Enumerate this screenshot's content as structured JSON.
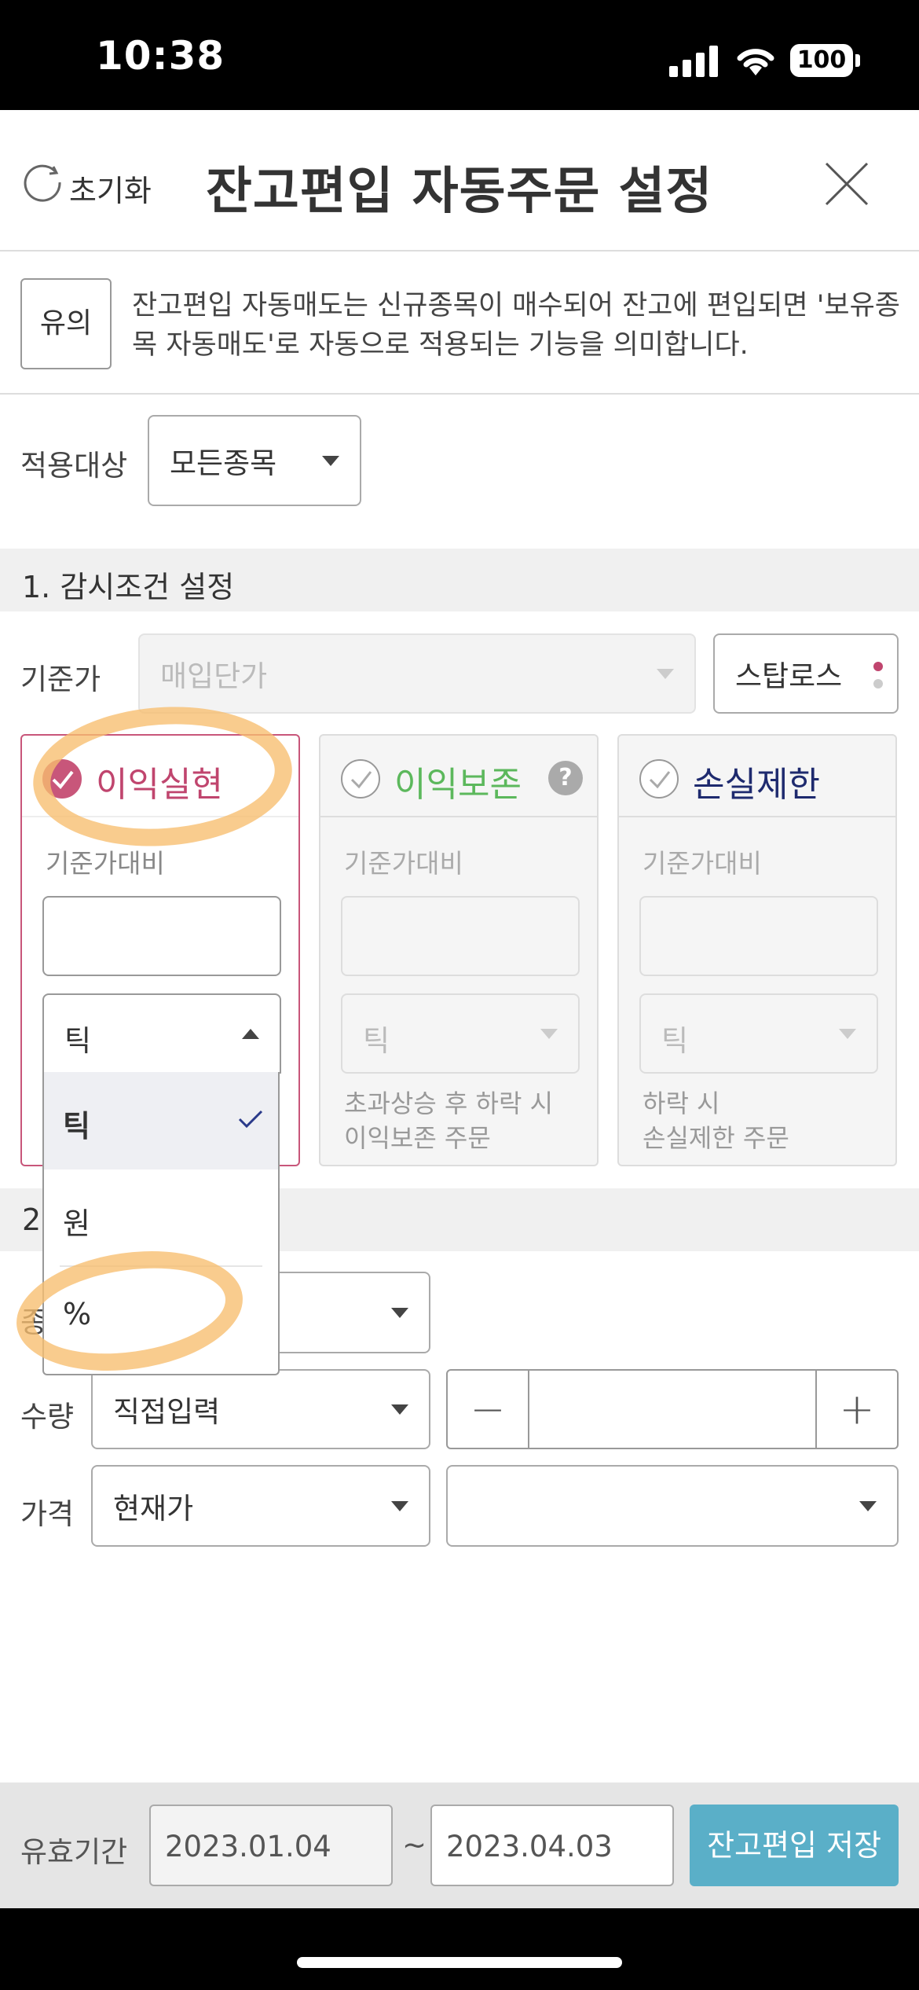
{
  "status": {
    "time": "10:38",
    "battery": "100"
  },
  "header": {
    "reset_label": "초기화",
    "title": "잔고편입 자동주문 설정"
  },
  "notice": {
    "badge": "유의",
    "text": "잔고편입 자동매도는 신규종목이 매수되어 잔고에 편입되면 '보유종목 자동매도'로 자동으로 적용되는 기능을 의미합니다."
  },
  "target": {
    "label": "적용대상",
    "value": "모든종목"
  },
  "section1": {
    "title": "1. 감시조건 설정"
  },
  "base_price": {
    "label": "기준가",
    "value": "매입단가",
    "stoploss_button": "스탑로스"
  },
  "cards": [
    {
      "title": "이익실현",
      "sub": "기준가대비",
      "select": "틱",
      "note": "",
      "color": "#c0456e",
      "checked": true
    },
    {
      "title": "이익보존",
      "sub": "기준가대비",
      "select": "틱",
      "note_line1": "초과상승 후 하락 시",
      "note_line2": "이익보존 주문",
      "color": "#5cb85c",
      "help": "?"
    },
    {
      "title": "손실제한",
      "sub": "기준가대비",
      "select": "틱",
      "note_line1": "하락 시",
      "note_line2": "손실제한 주문",
      "color": "#1e2a6e"
    }
  ],
  "dropdown": {
    "options": [
      "틱",
      "원",
      "%"
    ],
    "selected": "틱"
  },
  "section2": {
    "title": "2."
  },
  "order": {
    "type_label": "종",
    "qty_label": "수량",
    "qty_value": "직접입력",
    "price_label": "가격",
    "price_value": "현재가",
    "price_type": ""
  },
  "footer": {
    "valid_label": "유효기간",
    "start_date": "2023.01.04",
    "tilde": "~",
    "end_date": "2023.04.03",
    "save": "잔고편입 저장"
  }
}
